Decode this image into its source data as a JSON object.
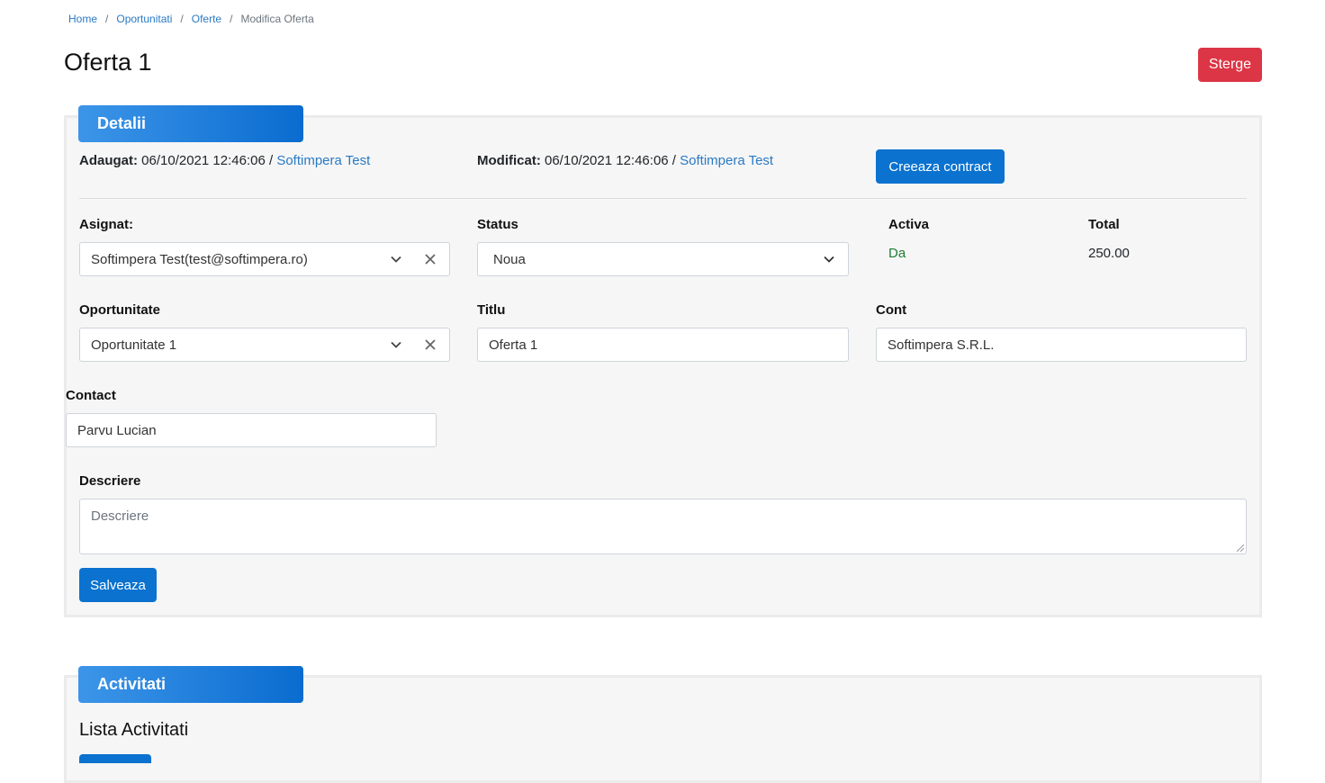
{
  "breadcrumb": {
    "items": [
      "Home",
      "Oportunitati",
      "Oferte"
    ],
    "current": "Modifica Oferta",
    "separator": "/"
  },
  "page": {
    "title": "Oferta 1",
    "delete_label": "Sterge"
  },
  "details": {
    "header": "Detalii",
    "added_label": "Adaugat:",
    "added_value": "06/10/2021 12:46:06 /",
    "added_user": "Softimpera Test",
    "modified_label": "Modificat:",
    "modified_value": "06/10/2021 12:46:06 /",
    "modified_user": "Softimpera Test",
    "create_contract_label": "Creeaza contract",
    "assigned_label": "Asignat:",
    "assigned_value": "Softimpera Test(test@softimpera.ro)",
    "status_label": "Status",
    "status_value": "Noua",
    "active_label": "Activa",
    "active_value": "Da",
    "total_label": "Total",
    "total_value": "250.00",
    "opportunity_label": "Oportunitate",
    "opportunity_value": "Oportunitate 1",
    "title_label": "Titlu",
    "title_value": "Oferta 1",
    "account_label": "Cont",
    "account_value": "Softimpera S.R.L.",
    "contact_label": "Contact",
    "contact_value": "Parvu Lucian",
    "description_label": "Descriere",
    "description_placeholder": "Descriere",
    "save_label": "Salveaza"
  },
  "activities": {
    "header": "Activitati",
    "list_title": "Lista Activitati"
  },
  "colors": {
    "primary": "#0b72cf",
    "danger": "#dc3545",
    "link": "#2a7ac4",
    "active_green": "#1e7e34",
    "card_bg": "#f6f6f6"
  }
}
